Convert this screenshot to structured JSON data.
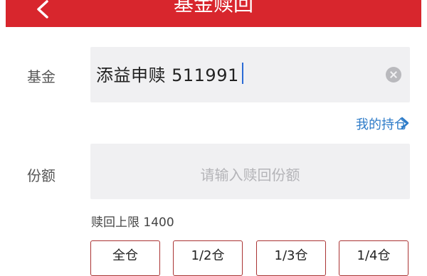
{
  "header": {
    "title": "基金赎回"
  },
  "fund": {
    "label": "基金",
    "value": "添益申赎 511991"
  },
  "holdings_link": {
    "label": "我的持仓"
  },
  "amount": {
    "label": "份额",
    "placeholder": "请输入赎回份额"
  },
  "limit": {
    "label": "赎回上限",
    "value": "1400"
  },
  "quick_buttons": [
    {
      "label": "全仓"
    },
    {
      "label": "1/2仓"
    },
    {
      "label": "1/3仓"
    },
    {
      "label": "1/4仓"
    }
  ],
  "colors": {
    "header": "#d8262d",
    "link": "#2d7bc8",
    "button_border": "#aa3333"
  }
}
